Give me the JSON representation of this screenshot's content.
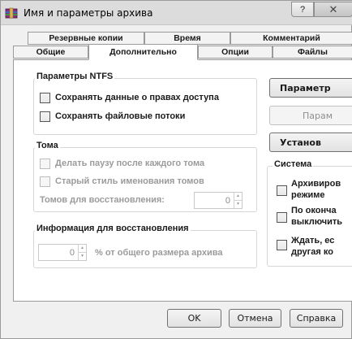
{
  "window": {
    "title": "Имя и параметры архива",
    "help_label": "?",
    "close_label": "✕",
    "icon": "winrar-archive-icon"
  },
  "tabs": {
    "row_back": [
      "Резервные копии",
      "Время",
      "Комментарий"
    ],
    "row_front": [
      "Общие",
      "Дополнительно",
      "Опции",
      "Файлы"
    ],
    "active": "Дополнительно"
  },
  "ntfs": {
    "title": "Параметры NTFS",
    "save_permissions": "Сохранять данные о правах доступа",
    "save_streams": "Сохранять файловые потоки"
  },
  "volumes": {
    "title": "Тома",
    "pause_after_volume": "Делать паузу после каждого тома",
    "old_naming": "Старый стиль именования томов",
    "recovery_volumes_label": "Томов для восстановления:",
    "recovery_volumes_value": "0"
  },
  "recovery": {
    "title": "Информация для восстановления",
    "value": "0",
    "unit_label": "% от общего размера архива"
  },
  "side_buttons": {
    "compression": "Параметр",
    "sfx": "Парам",
    "password": "Установ"
  },
  "system": {
    "title": "Система",
    "background": [
      "Архивиров",
      "режиме"
    ],
    "shutdown": [
      "По оконча",
      "выключить"
    ],
    "wait": [
      "Ждать, ес",
      "другая ко"
    ]
  },
  "footer": {
    "ok": "OK",
    "cancel": "Отмена",
    "help": "Справка"
  }
}
